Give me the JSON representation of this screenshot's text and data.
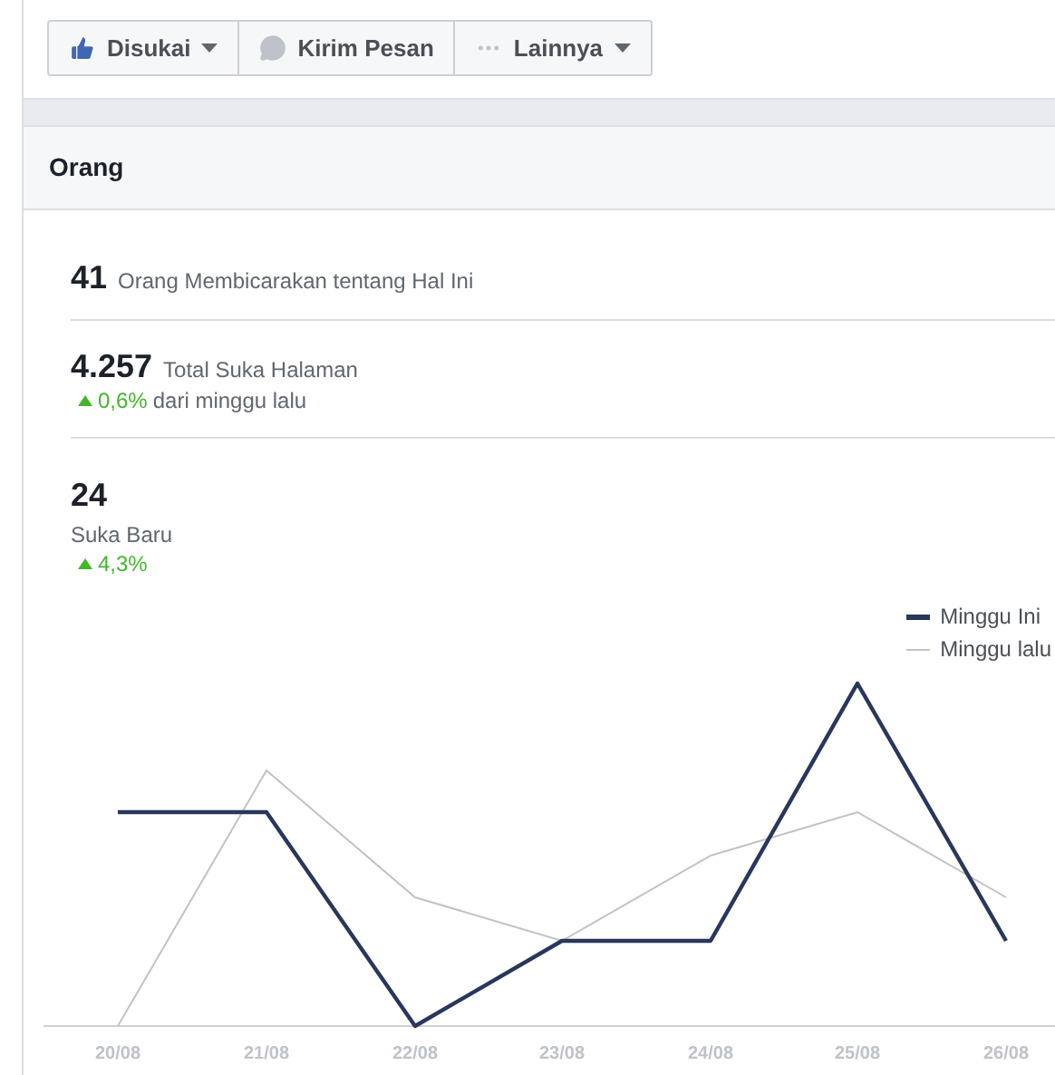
{
  "actions": [
    {
      "kind": "like",
      "label": "Disukai",
      "dropdown": true
    },
    {
      "kind": "message",
      "label": "Kirim Pesan",
      "dropdown": false
    },
    {
      "kind": "more",
      "label": "Lainnya",
      "dropdown": true
    }
  ],
  "section": {
    "title": "Orang"
  },
  "stats": [
    {
      "kind": "inline",
      "value": "41",
      "label": "Orang Membicarakan tentang Hal Ini"
    },
    {
      "kind": "inline",
      "value": "4.257",
      "label": "Total Suka Halaman",
      "change": {
        "kind": "up",
        "value": "0,6%",
        "note": "dari minggu lalu"
      }
    },
    {
      "kind": "stacked",
      "value": "24",
      "label": "Suka Baru",
      "change": {
        "kind": "up",
        "value": "4,3%"
      }
    }
  ],
  "chart": {
    "legend": [
      {
        "kind": "current",
        "label": "Minggu Ini"
      },
      {
        "kind": "previous",
        "label": "Minggu lalu"
      }
    ],
    "x_labels": [
      "20/08",
      "21/08",
      "22/08",
      "23/08",
      "24/08",
      "25/08",
      "26/08"
    ]
  }
}
